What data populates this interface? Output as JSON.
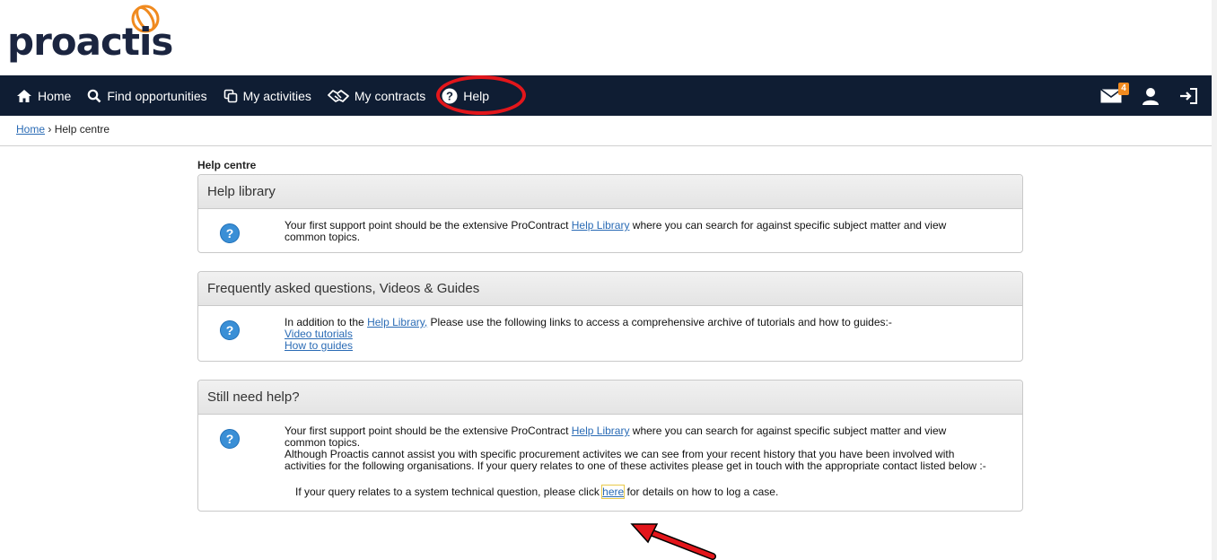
{
  "brand": {
    "name": "proactis",
    "accent": "#f08a1f",
    "navy": "#0f1d33"
  },
  "nav": {
    "items": [
      {
        "label": "Home",
        "icon": "home-icon"
      },
      {
        "label": "Find opportunities",
        "icon": "search-icon"
      },
      {
        "label": "My activities",
        "icon": "copy-icon"
      },
      {
        "label": "My contracts",
        "icon": "handshake-icon"
      },
      {
        "label": "Help",
        "icon": "help-icon"
      }
    ],
    "mail_badge": "4"
  },
  "breadcrumb": {
    "home": "Home",
    "sep": "›",
    "current": "Help centre"
  },
  "page": {
    "title": "Help centre"
  },
  "panels": {
    "library": {
      "title": "Help library",
      "text_before": "Your first support point should be the extensive ProContract ",
      "link": "Help Library",
      "text_after": " where you can search for against specific subject matter and view common topics."
    },
    "faq": {
      "title": "Frequently asked questions, Videos & Guides",
      "text_before": "In addition to the ",
      "link": "Help Library,",
      "text_after": " Please use the following links to access a comprehensive archive of tutorials and how to guides:-",
      "link_videos": "Video tutorials",
      "link_guides": "How to guides"
    },
    "still": {
      "title": "Still need help?",
      "text_before": "Your first support point should be the extensive ProContract ",
      "link": "Help Library",
      "text_after": " where you can search for against specific subject matter and view common topics.",
      "para2": "Although Proactis cannot assist you with specific procurement activites we can see from your recent history that you have been involved with activities for the following organisations. If your query relates to one of these activites please get in touch with the appropriate contact listed below :-",
      "click_before": "If your query relates to a system technical question, please click ",
      "click_link": "here",
      "click_after": " for details on how to log a case."
    }
  }
}
